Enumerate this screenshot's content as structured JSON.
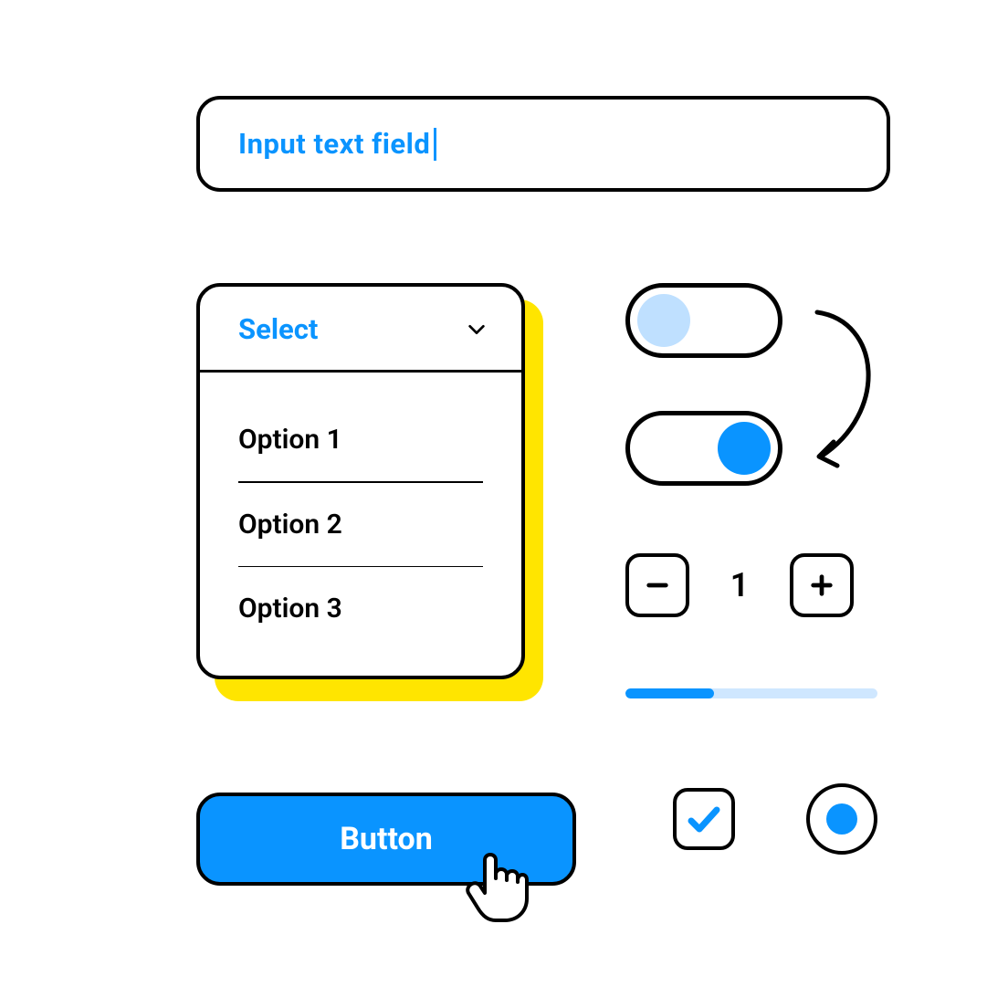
{
  "colors": {
    "accent": "#0a94ff",
    "highlight": "#ffe500",
    "track_light": "#cfe7ff",
    "knob_off": "#bfe0ff"
  },
  "input": {
    "placeholder": "Input text field"
  },
  "dropdown": {
    "label": "Select",
    "options": [
      "Option 1",
      "Option 2",
      "Option 3"
    ]
  },
  "toggle": {
    "off_state": "off",
    "on_state": "on"
  },
  "stepper": {
    "value": "1"
  },
  "slider": {
    "percent": 35
  },
  "button": {
    "label": "Button"
  },
  "checkbox": {
    "checked": true
  },
  "radio": {
    "selected": true
  }
}
